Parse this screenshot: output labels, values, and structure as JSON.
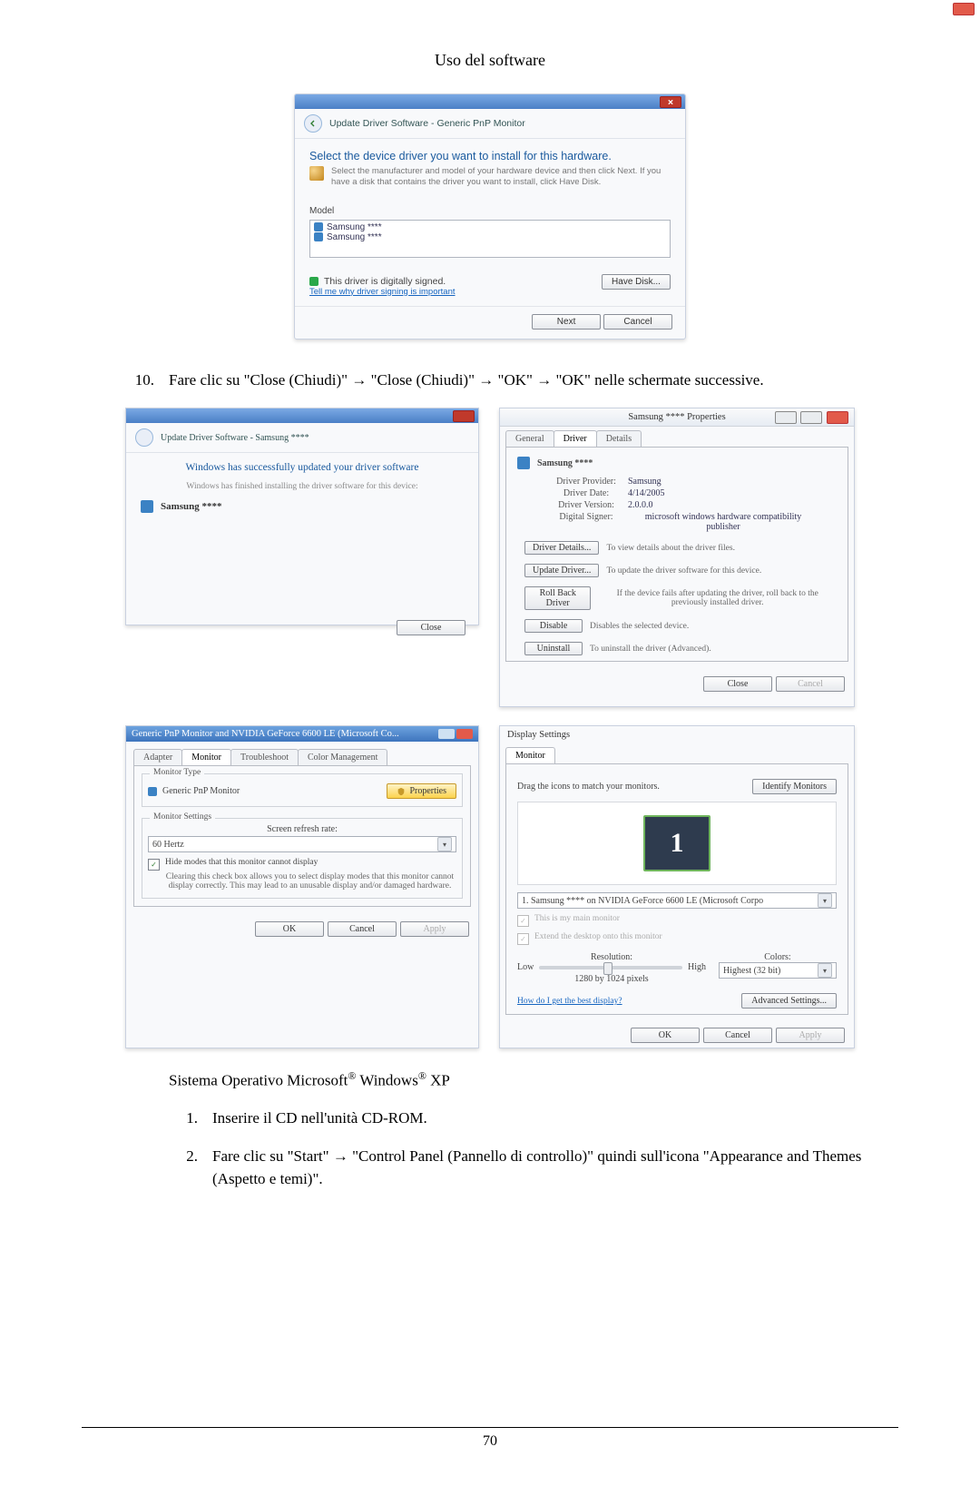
{
  "running_head": "Uso del software",
  "page_number": "70",
  "step10_num": "10.",
  "step10_text": "Fare clic su \"Close (Chiudi)\" → \"Close (Chiudi)\" → \"OK\" → \"OK\" nelle schermate successive.",
  "os_line_prefix": "Sistema Operativo Microsoft",
  "os_line_mid": " Windows",
  "os_line_suffix": " XP",
  "stepA_num": "1.",
  "stepA_text": "Inserire il CD nell'unità CD-ROM.",
  "stepB_num": "2.",
  "stepB_text": "Fare clic su \"Start\" → \"Control Panel (Pannello di controllo)\" quindi sull'icona \"Appearance and Themes (Aspetto e temi)\".",
  "drv_select": {
    "crumb": "Update Driver Software - Generic PnP Monitor",
    "title": "Select the device driver you want to install for this hardware.",
    "help": "Select the manufacturer and model of your hardware device and then click Next. If you have a disk that contains the driver you want to install, click Have Disk.",
    "model_label": "Model",
    "item1": "Samsung ****",
    "item2": "Samsung ****",
    "signed": "This driver is digitally signed.",
    "signed_link": "Tell me why driver signing is important",
    "have_disk": "Have Disk...",
    "next": "Next",
    "cancel": "Cancel"
  },
  "success": {
    "crumb": "Update Driver Software - Samsung ****",
    "title": "Windows has successfully updated your driver software",
    "sub": "Windows has finished installing the driver software for this device:",
    "device": "Samsung ****",
    "close": "Close"
  },
  "prop": {
    "title": "Samsung **** Properties",
    "tab_general": "General",
    "tab_driver": "Driver",
    "tab_details": "Details",
    "device": "Samsung ****",
    "kv": {
      "provider_k": "Driver Provider:",
      "provider_v": "Samsung",
      "date_k": "Driver Date:",
      "date_v": "4/14/2005",
      "version_k": "Driver Version:",
      "version_v": "2.0.0.0",
      "signer_k": "Digital Signer:",
      "signer_v": "microsoft windows hardware compatibility publisher"
    },
    "btn_details": "Driver Details...",
    "btn_details_d": "To view details about the driver files.",
    "btn_update": "Update Driver...",
    "btn_update_d": "To update the driver software for this device.",
    "btn_rollback": "Roll Back Driver",
    "btn_rollback_d": "If the device fails after updating the driver, roll back to the previously installed driver.",
    "btn_disable": "Disable",
    "btn_disable_d": "Disables the selected device.",
    "btn_uninstall": "Uninstall",
    "btn_uninstall_d": "To uninstall the driver (Advanced).",
    "close": "Close",
    "cancel": "Cancel"
  },
  "mon": {
    "title": "Generic PnP Monitor and NVIDIA GeForce 6600 LE (Microsoft Co...",
    "tab_adapter": "Adapter",
    "tab_monitor": "Monitor",
    "tab_troubleshoot": "Troubleshoot",
    "tab_color": "Color Management",
    "grp_type": "Monitor Type",
    "type_name": "Generic PnP Monitor",
    "btn_prop": "Properties",
    "grp_settings": "Monitor Settings",
    "refresh_lbl": "Screen refresh rate:",
    "refresh_val": "60 Hertz",
    "chk_hide": "Hide modes that this monitor cannot display",
    "chk_note": "Clearing this check box allows you to select display modes that this monitor cannot display correctly. This may lead to an unusable display and/or damaged hardware.",
    "ok": "OK",
    "cancel": "Cancel",
    "apply": "Apply"
  },
  "disp": {
    "title": "Display Settings",
    "tab_monitor": "Monitor",
    "drag": "Drag the icons to match your monitors.",
    "identify": "Identify Monitors",
    "big1": "1",
    "sel": "1. Samsung **** on NVIDIA GeForce 6600 LE (Microsoft Corpo",
    "chk_main": "This is my main monitor",
    "chk_extend": "Extend the desktop onto this monitor",
    "res_lbl": "Resolution:",
    "res_low": "Low",
    "res_high": "High",
    "res_val": "1280 by 1024 pixels",
    "col_lbl": "Colors:",
    "col_val": "Highest (32 bit)",
    "link": "How do I get the best display?",
    "advanced": "Advanced Settings...",
    "ok": "OK",
    "cancel": "Cancel",
    "apply": "Apply"
  }
}
